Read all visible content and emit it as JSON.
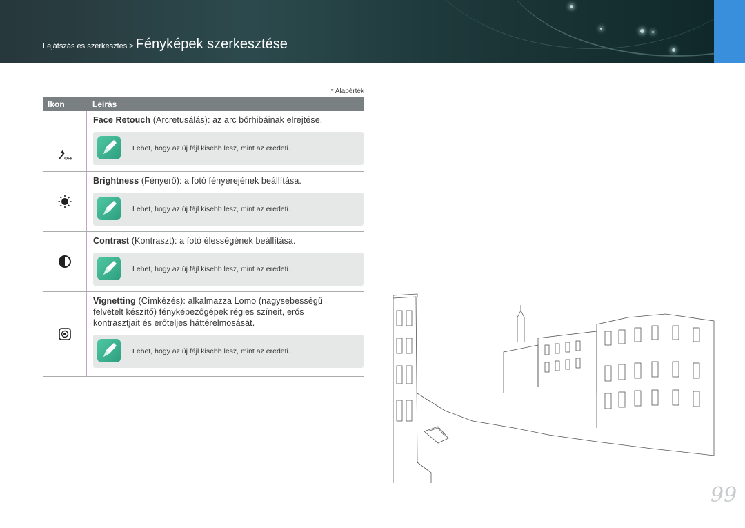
{
  "header": {
    "breadcrumb_section": "Lejátszás és szerkesztés",
    "breadcrumb_separator": ">",
    "page_title": "Fényképek szerkesztése"
  },
  "default_note": "* Alapérték",
  "table": {
    "col_icon": "Ikon",
    "col_desc": "Leírás",
    "rows": [
      {
        "icon": "face-retouch-off-icon",
        "name": "Face Retouch",
        "desc": " (Arcretusálás): az arc bőrhibáinak elrejtése.",
        "note": "Lehet, hogy az új fájl kisebb lesz, mint az eredeti."
      },
      {
        "icon": "brightness-icon",
        "name": "Brightness",
        "desc": " (Fényerő): a fotó fényerejének beállítása.",
        "note": "Lehet, hogy az új fájl kisebb lesz, mint az eredeti."
      },
      {
        "icon": "contrast-icon",
        "name": "Contrast",
        "desc": " (Kontraszt): a fotó élességének beállítása.",
        "note": "Lehet, hogy az új fájl kisebb lesz, mint az eredeti."
      },
      {
        "icon": "vignetting-icon",
        "name": "Vignetting",
        "desc": " (Címkézés): alkalmazza Lomo (nagysebességű felvételt készítő) fényképezőgépek régies színeit, erős kontrasztjait és erőteljes háttérelmosását.",
        "note": "Lehet, hogy az új fájl kisebb lesz, mint az eredeti."
      }
    ]
  },
  "page_number": "99",
  "colors": {
    "banner": "#27373b",
    "accent_tab": "#3a8fdc",
    "table_header": "#7a7f81",
    "note_icon": "#3fb792"
  }
}
